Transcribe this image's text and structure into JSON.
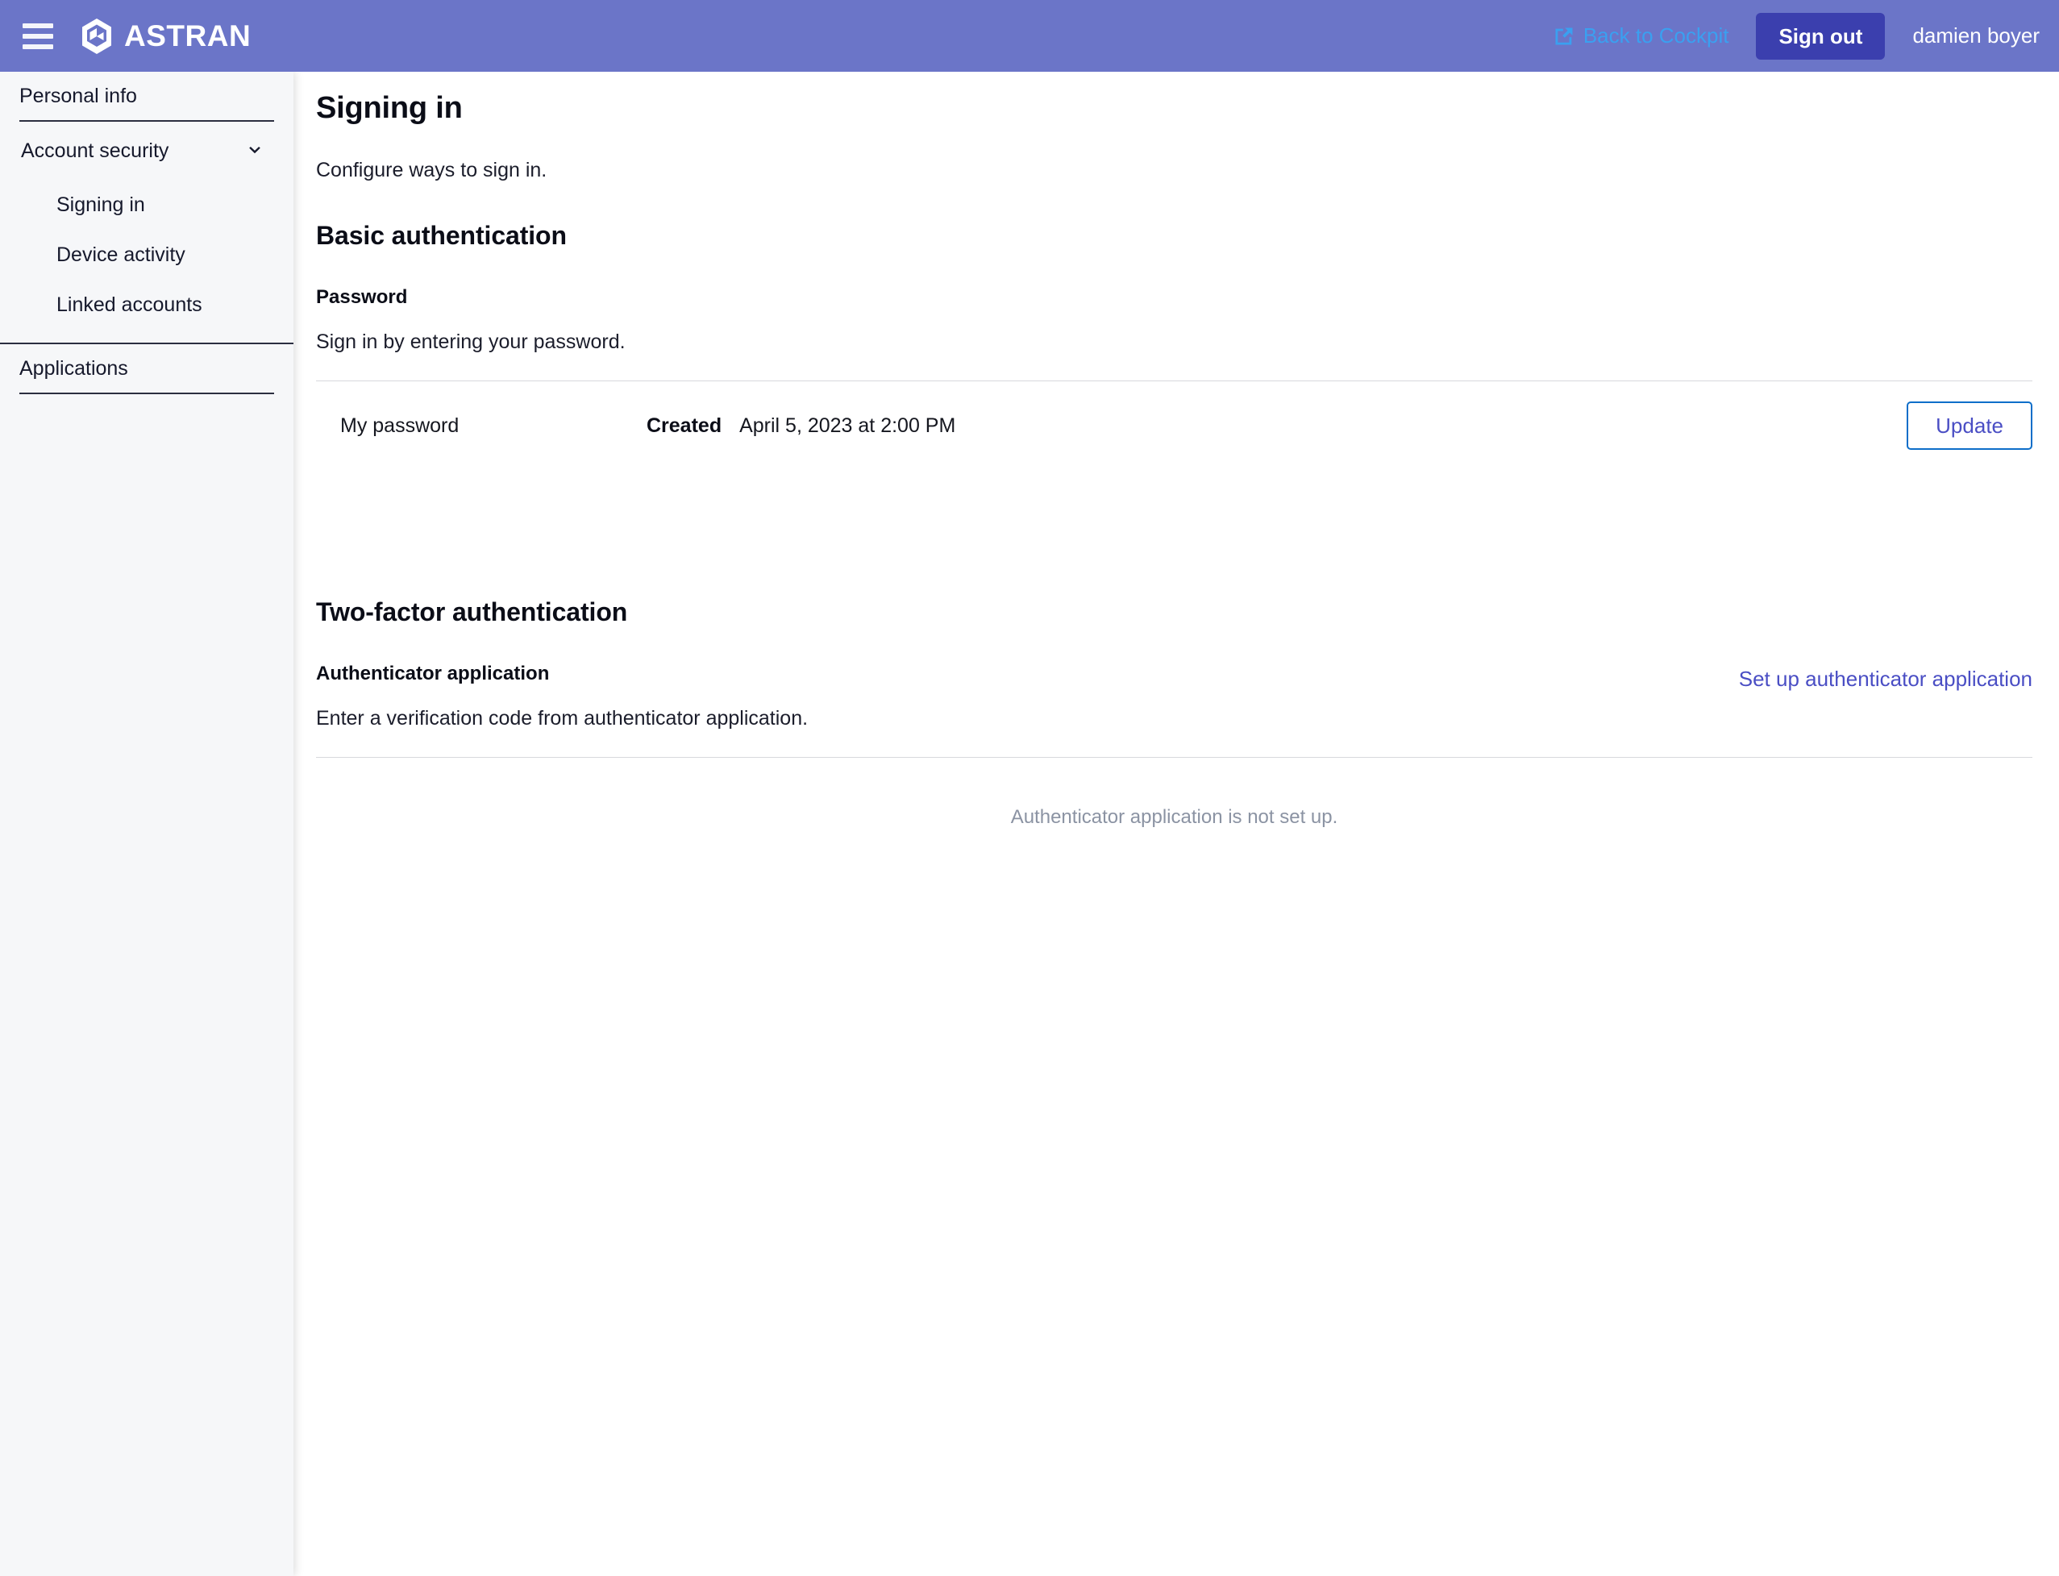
{
  "header": {
    "menu_icon": "hamburger-icon",
    "brand_icon": "astran-hex-logo-icon",
    "brand_name": "ASTRAN",
    "back_link": {
      "icon": "external-link-icon",
      "label": "Back to Cockpit"
    },
    "signout_label": "Sign out",
    "username": "damien boyer",
    "bg_color": "#6b75c8",
    "signout_color": "#3b3fae",
    "back_link_color": "#3aa0f0"
  },
  "sidebar": {
    "groups": [
      {
        "root": {
          "label": "Personal info"
        },
        "children": []
      },
      {
        "root": {
          "label": "Account security",
          "expanded": true,
          "icon": "chevron-down-icon"
        },
        "children": [
          {
            "label": "Signing in",
            "active": true
          },
          {
            "label": "Device activity",
            "active": false
          },
          {
            "label": "Linked accounts",
            "active": false
          }
        ]
      },
      {
        "root": {
          "label": "Applications"
        },
        "children": []
      }
    ]
  },
  "main": {
    "page_title": "Signing in",
    "page_subtitle": "Configure ways to sign in.",
    "basic_auth": {
      "section_title": "Basic authentication",
      "field_label": "Password",
      "field_desc": "Sign in by entering your password.",
      "credential": {
        "name": "My password",
        "meta_key": "Created",
        "meta_value": "April 5, 2023 at 2:00 PM",
        "action_label": "Update"
      }
    },
    "two_factor": {
      "section_title": "Two-factor authentication",
      "field_label": "Authenticator application",
      "field_desc": "Enter a verification code from authenticator application.",
      "setup_link_label": "Set up authenticator application",
      "empty_message": "Authenticator application is not set up."
    }
  }
}
